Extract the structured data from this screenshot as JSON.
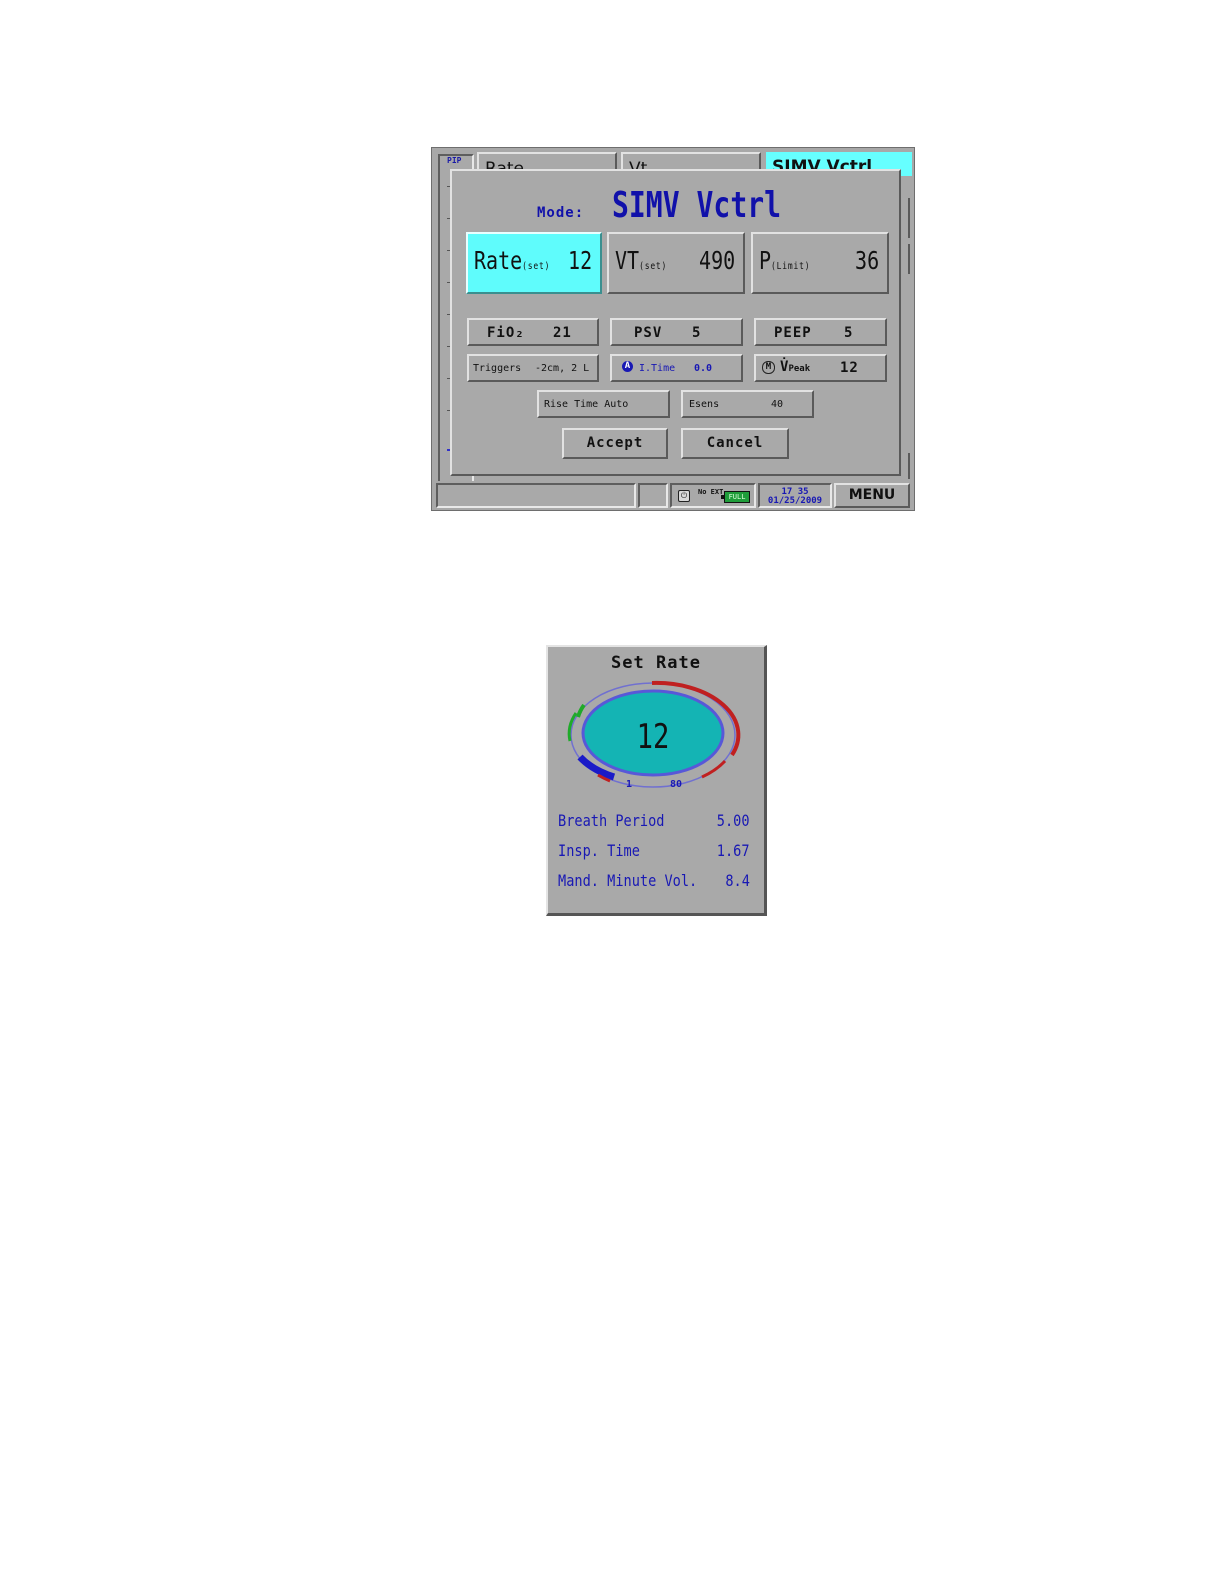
{
  "background": {
    "pip_label": "PIP",
    "tabs": [
      "Rate",
      "Vt",
      "SIMV Vctrl"
    ]
  },
  "dialog": {
    "mode_label": "Mode:",
    "mode_value": "SIMV Vctrl",
    "rate": {
      "label": "Rate",
      "sub": "(set)",
      "value": "12"
    },
    "vt": {
      "label": "VT",
      "sub": "(set)",
      "value": "490"
    },
    "plimit": {
      "label": "P",
      "sub": "(Limit)",
      "value": "36"
    },
    "fio2": {
      "label": "FiO₂",
      "value": "21"
    },
    "psv": {
      "label": "PSV",
      "value": "5"
    },
    "peep": {
      "label": "PEEP",
      "value": "5"
    },
    "triggers": {
      "label": "Triggers",
      "value": "-2cm, 2 L"
    },
    "itime": {
      "badge": "A",
      "label": "I.Time",
      "value": "0.0"
    },
    "vpeak": {
      "badge": "M",
      "label": "V̇",
      "sub": "Peak",
      "value": "12"
    },
    "rise_time": "Rise Time Auto",
    "esens": {
      "label": "Esens",
      "value": "40"
    },
    "accept_label": "Accept",
    "cancel_label": "Cancel"
  },
  "status_bar": {
    "no_ext": "No EXT",
    "battery": "FULL",
    "time": "17 35",
    "date": "01/25/2009",
    "menu_label": "MENU"
  },
  "set_rate_panel": {
    "title": "Set Rate",
    "value": "12",
    "level": 0.14,
    "min": "1",
    "max": "80",
    "rows": [
      {
        "label": "Breath Period",
        "value": "5.00"
      },
      {
        "label": "Insp. Time",
        "value": "1.67"
      },
      {
        "label": "Mand. Minute Vol.",
        "value": "8.4"
      }
    ]
  },
  "colors": {
    "highlight": "#5ffcfc",
    "text_blue": "#1818b4",
    "gauge_fill": "#14b4b4",
    "gauge_green": "#1faa2a",
    "gauge_red": "#c02020",
    "gauge_blue": "#1a1ac8"
  }
}
